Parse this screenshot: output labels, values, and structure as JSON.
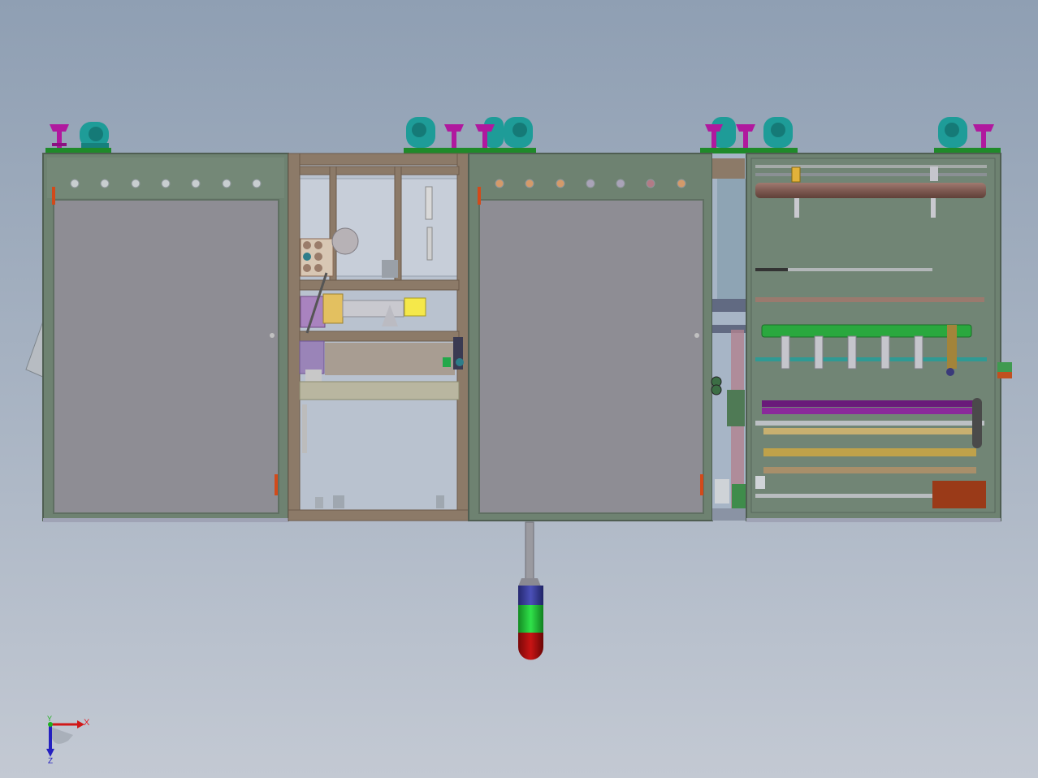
{
  "colors": {
    "background_top": "#8f9fb3",
    "background_bottom": "#c3c9d3",
    "panel": "#6e8271",
    "door": "#8e8d94",
    "frame_wood": "#8c7a68",
    "caster_teal": "#1e9c98",
    "caster_magenta": "#b0199e",
    "base_green": "#1f8a2a",
    "light_blue": "#3b3f9a",
    "light_green": "#23c43a",
    "light_red": "#b01010"
  },
  "icons": {
    "axis_triad": "coordinate-triad-icon"
  },
  "triad": {
    "x_label": "X",
    "y_label": "Y",
    "z_label": "Z"
  }
}
